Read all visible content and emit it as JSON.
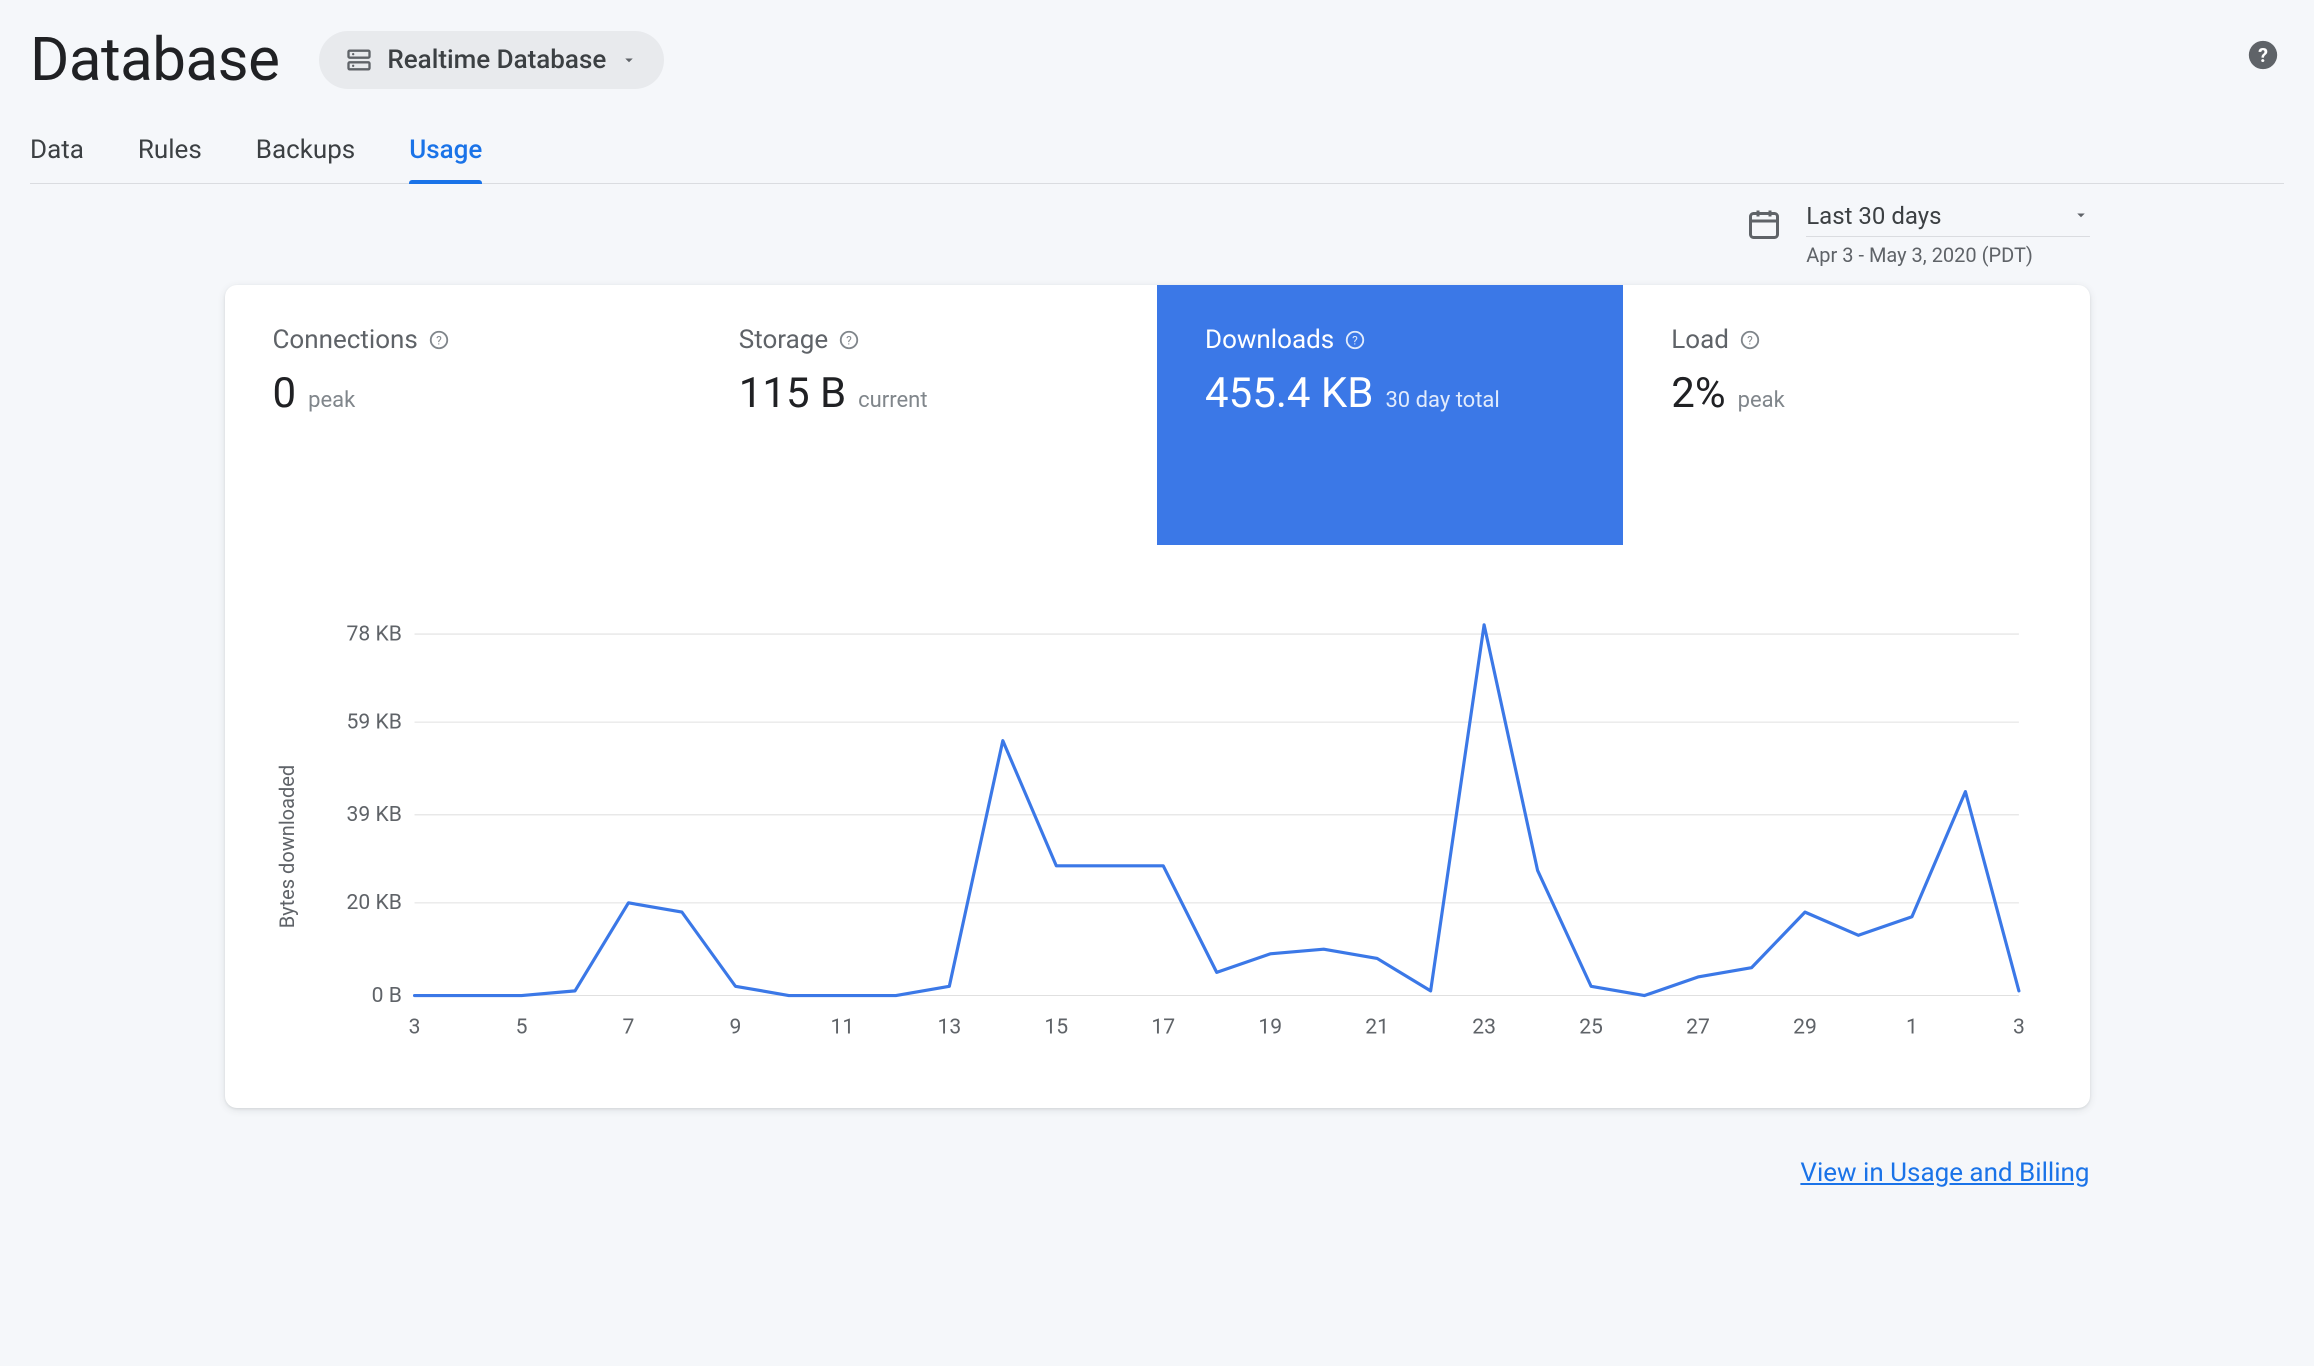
{
  "header": {
    "title": "Database",
    "selector_label": "Realtime Database"
  },
  "tabs": [
    "Data",
    "Rules",
    "Backups",
    "Usage"
  ],
  "active_tab": "Usage",
  "date_range": {
    "label": "Last 30 days",
    "sub": "Apr 3 - May 3, 2020 (PDT)"
  },
  "metrics": {
    "connections": {
      "title": "Connections",
      "value": "0",
      "sub": "peak"
    },
    "storage": {
      "title": "Storage",
      "value": "115 B",
      "sub": "current"
    },
    "downloads": {
      "title": "Downloads",
      "value": "455.4 KB",
      "sub": "30 day total"
    },
    "load": {
      "title": "Load",
      "value": "2%",
      "sub": "peak"
    }
  },
  "active_metric": "downloads",
  "footer_link": "View in Usage and Billing",
  "chart_data": {
    "type": "line",
    "title": "Downloads",
    "xlabel": "",
    "ylabel": "Bytes downloaded",
    "ylim": [
      0,
      82
    ],
    "y_ticks": [
      {
        "label": "0 B",
        "value": 0
      },
      {
        "label": "20 KB",
        "value": 20
      },
      {
        "label": "39 KB",
        "value": 39
      },
      {
        "label": "59 KB",
        "value": 59
      },
      {
        "label": "78 KB",
        "value": 78
      }
    ],
    "x_ticks": [
      "3",
      "5",
      "7",
      "9",
      "11",
      "13",
      "15",
      "17",
      "19",
      "21",
      "23",
      "25",
      "27",
      "29",
      "1",
      "3"
    ],
    "x": [
      3,
      4,
      5,
      6,
      7,
      8,
      9,
      10,
      11,
      12,
      13,
      14,
      15,
      16,
      17,
      18,
      19,
      20,
      21,
      22,
      23,
      24,
      25,
      26,
      27,
      28,
      29,
      30,
      1,
      2,
      3
    ],
    "values": [
      0,
      0,
      0,
      1,
      20,
      18,
      2,
      0,
      0,
      0,
      2,
      55,
      28,
      28,
      28,
      5,
      9,
      10,
      8,
      1,
      80,
      27,
      2,
      0,
      4,
      6,
      18,
      13,
      17,
      44,
      1
    ],
    "line_color": "#3b78e7"
  }
}
